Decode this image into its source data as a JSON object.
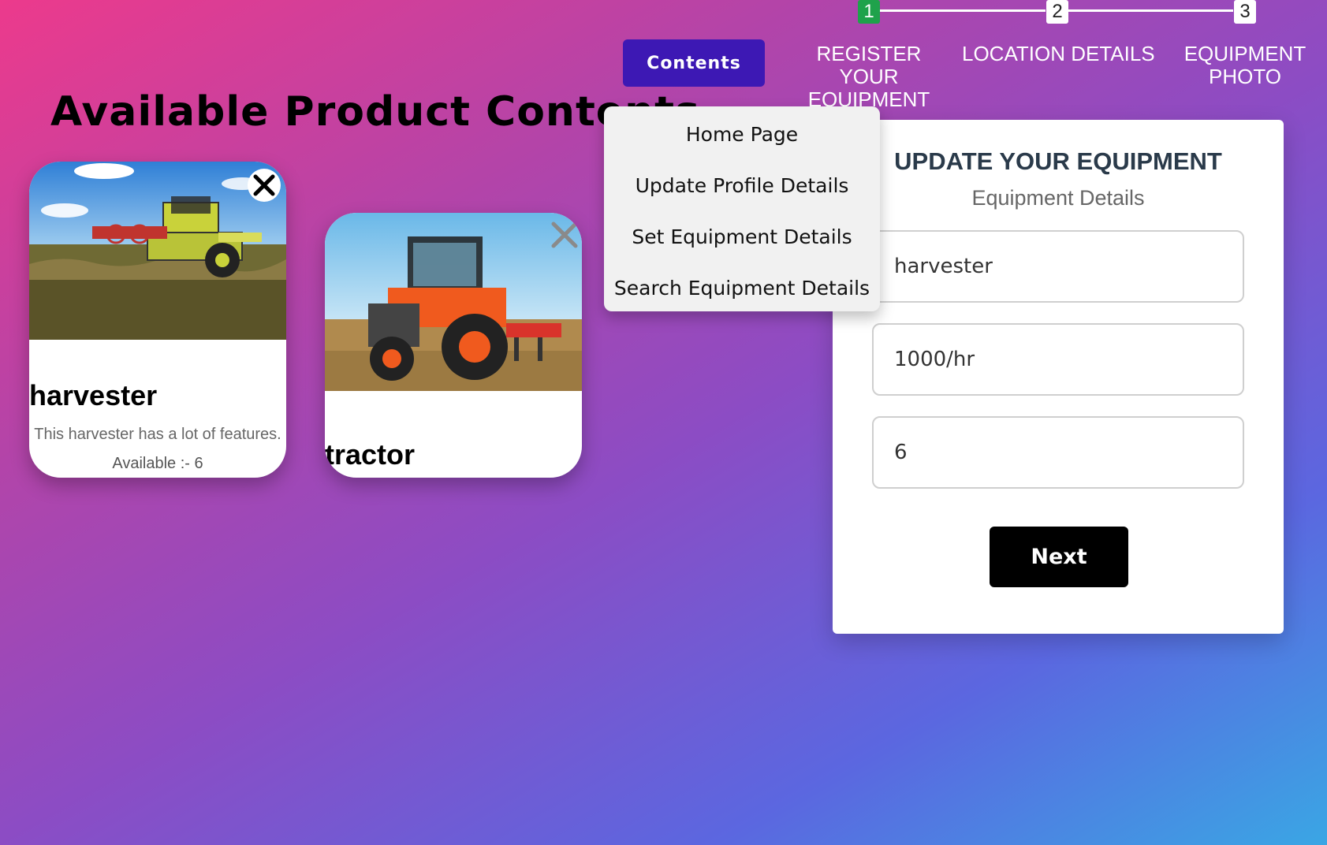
{
  "stepper": {
    "steps": [
      {
        "number": "1",
        "label": "REGISTER YOUR\nEQUIPMENT",
        "active": true
      },
      {
        "number": "2",
        "label": "LOCATION DETAILS",
        "active": false
      },
      {
        "number": "3",
        "label": "EQUIPMENT\nPHOTO",
        "active": false
      }
    ],
    "active_color": "#1fa24b"
  },
  "contents_button": {
    "label": "Contents",
    "color": "#3d18b4"
  },
  "dropdown": {
    "items": [
      "Home Page",
      "Update Profile Details",
      "Set Equipment Details",
      "Search Equipment Details"
    ]
  },
  "page_heading": "Available Product Contents",
  "products": [
    {
      "name": "harvester",
      "description": "This harvester has a lot of features.",
      "available": "Available :- 6",
      "image": "combine-harvester-photo"
    },
    {
      "name": "tractor",
      "image": "orange-tractor-photo"
    }
  ],
  "form": {
    "title": "UPDATE YOUR EQUIPMENT",
    "subtitle": "Equipment Details",
    "fields": [
      {
        "value": "harvester"
      },
      {
        "value": "1000/hr"
      },
      {
        "value": "6"
      }
    ],
    "next_label": "Next"
  }
}
